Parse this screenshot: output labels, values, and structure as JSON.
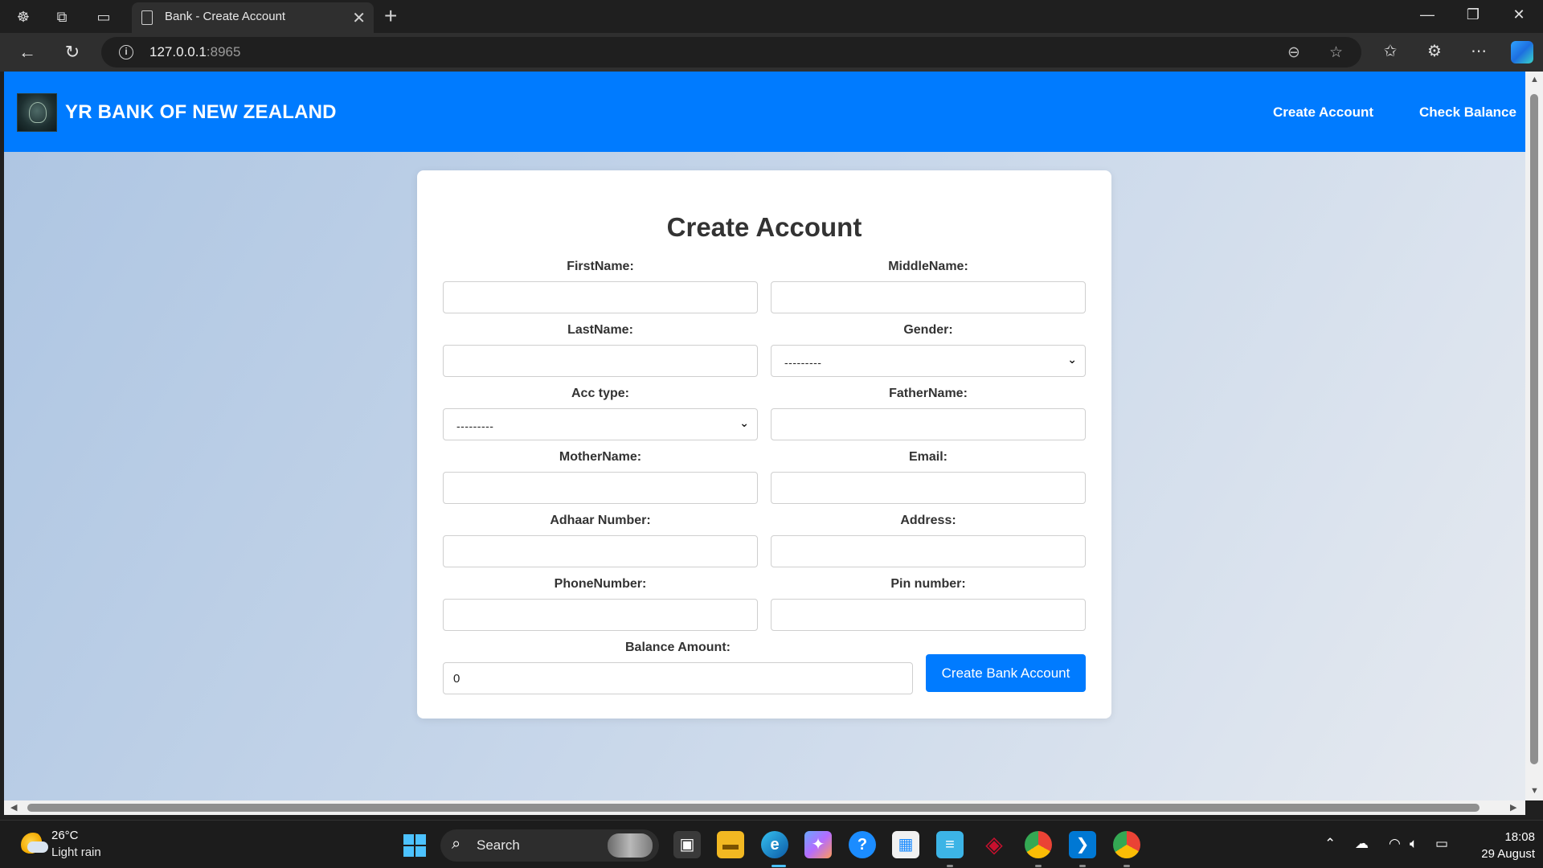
{
  "browser": {
    "tab_title": "Bank - Create Account",
    "url_host": "127.0.0.1",
    "url_port": ":8965"
  },
  "navbar": {
    "brand": "YR BANK OF NEW ZEALAND",
    "links": [
      "Create Account",
      "Check Balance"
    ]
  },
  "form": {
    "title": "Create Account",
    "fields": {
      "first_name": {
        "label": "FirstName:",
        "value": ""
      },
      "middle_name": {
        "label": "MiddleName:",
        "value": ""
      },
      "last_name": {
        "label": "LastName:",
        "value": ""
      },
      "gender": {
        "label": "Gender:",
        "selected": "---------"
      },
      "acc_type": {
        "label": "Acc type:",
        "selected": "---------"
      },
      "father_name": {
        "label": "FatherName:",
        "value": ""
      },
      "mother_name": {
        "label": "MotherName:",
        "value": ""
      },
      "email": {
        "label": "Email:",
        "value": ""
      },
      "adhaar_number": {
        "label": "Adhaar Number:",
        "value": ""
      },
      "address": {
        "label": "Address:",
        "value": ""
      },
      "phone_number": {
        "label": "PhoneNumber:",
        "value": ""
      },
      "pin_number": {
        "label": "Pin number:",
        "value": ""
      },
      "balance_amount": {
        "label": "Balance Amount:",
        "value": "0"
      }
    },
    "submit_label": "Create Bank Account"
  },
  "taskbar": {
    "weather_temp": "26°C",
    "weather_desc": "Light rain",
    "search_label": "Search",
    "time": "18:08",
    "date": "29 August"
  },
  "colors": {
    "accent": "#007bff",
    "card": "#ffffff",
    "heading": "#333333"
  }
}
